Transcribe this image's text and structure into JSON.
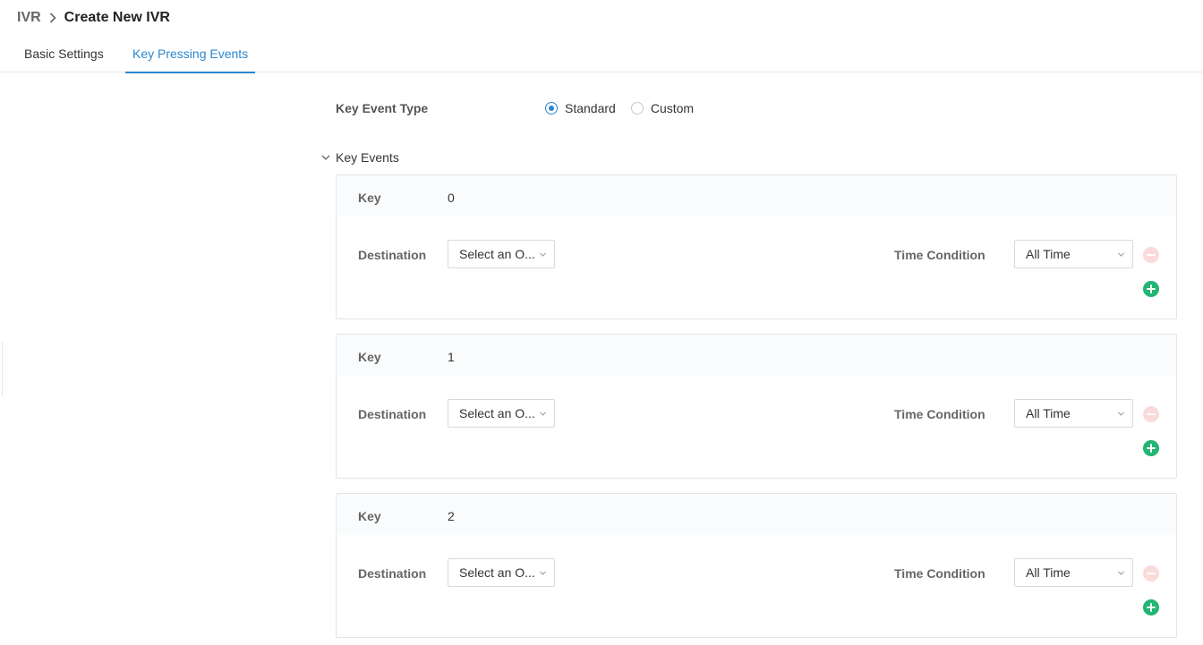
{
  "breadcrumb": {
    "parent": "IVR",
    "current": "Create New IVR"
  },
  "tabs": [
    {
      "label": "Basic Settings",
      "active": false
    },
    {
      "label": "Key Pressing Events",
      "active": true
    }
  ],
  "key_event_type": {
    "label": "Key Event Type",
    "options": [
      {
        "label": "Standard",
        "checked": true
      },
      {
        "label": "Custom",
        "checked": false
      }
    ]
  },
  "key_events": {
    "section_label": "Key Events",
    "key_label": "Key",
    "destination_label": "Destination",
    "time_condition_label": "Time Condition",
    "items": [
      {
        "key": "0",
        "destination": "Select an O...",
        "time_condition": "All Time"
      },
      {
        "key": "1",
        "destination": "Select an O...",
        "time_condition": "All Time"
      },
      {
        "key": "2",
        "destination": "Select an O...",
        "time_condition": "All Time"
      }
    ]
  },
  "colors": {
    "accent": "#2a87d0",
    "add": "#22b573",
    "remove_disabled": "#fbdada"
  }
}
